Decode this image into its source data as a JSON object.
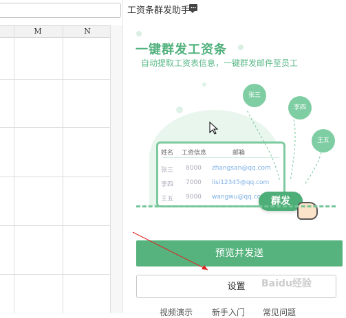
{
  "spreadsheet": {
    "columns": [
      "M",
      "N"
    ]
  },
  "panel": {
    "title": "工资条群发助手",
    "hero_title": "一键群发工资条",
    "hero_subtitle": "自动提取工资表信息，一键群发邮件至员工",
    "table": {
      "headers": [
        "姓名",
        "工资信息",
        "邮箱"
      ],
      "rows": [
        {
          "name": "张三",
          "salary": "8000",
          "email": "zhangsan@qq.com"
        },
        {
          "name": "李四",
          "salary": "7000",
          "email": "lisi12345@qq.com"
        },
        {
          "name": "王五",
          "salary": "9000",
          "email": "wangwu@qq.com"
        }
      ]
    },
    "avatars": [
      "张三",
      "李四",
      "王五"
    ],
    "send_label": "群发",
    "preview_button": "预览并发送",
    "settings_button": "设置",
    "footer_links": [
      "视频演示",
      "新手入门",
      "常见问题"
    ],
    "watermark": "Baidu经验",
    "accent_color": "#57b37e"
  }
}
